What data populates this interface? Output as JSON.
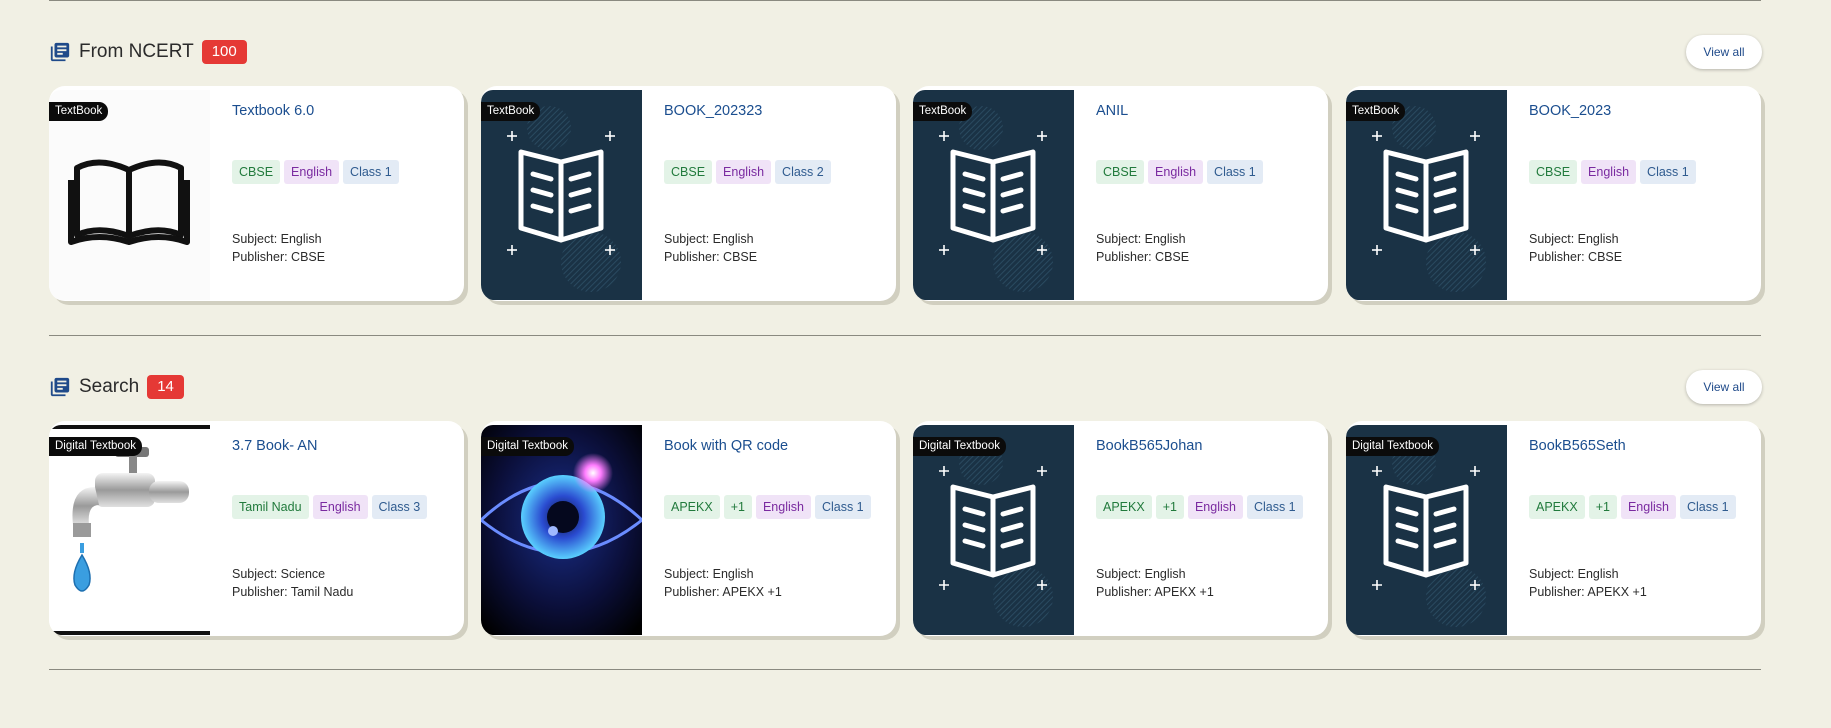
{
  "sections": [
    {
      "title": "From NCERT",
      "count": "100",
      "view_all": "View all",
      "icon": "library-books-icon",
      "cards": [
        {
          "type": "TextBook",
          "title": "Textbook 6.0",
          "tags": [
            "CBSE",
            "English",
            "Class 1"
          ],
          "subject": "Subject: English",
          "publisher": "Publisher: CBSE",
          "thumb": "open-book-photo"
        },
        {
          "type": "TextBook",
          "title": "BOOK_202323",
          "tags": [
            "CBSE",
            "English",
            "Class 2"
          ],
          "subject": "Subject: English",
          "publisher": "Publisher: CBSE",
          "thumb": "default-book-cover"
        },
        {
          "type": "TextBook",
          "title": "ANIL",
          "tags": [
            "CBSE",
            "English",
            "Class 1"
          ],
          "subject": "Subject: English",
          "publisher": "Publisher: CBSE",
          "thumb": "default-book-cover"
        },
        {
          "type": "TextBook",
          "title": "BOOK_2023",
          "tags": [
            "CBSE",
            "English",
            "Class 1"
          ],
          "subject": "Subject: English",
          "publisher": "Publisher: CBSE",
          "thumb": "default-book-cover"
        }
      ]
    },
    {
      "title": "Search",
      "count": "14",
      "view_all": "View all",
      "icon": "library-books-icon",
      "cards": [
        {
          "type": "Digital Textbook",
          "title": "3.7 Book- AN",
          "tags": [
            "Tamil Nadu",
            "English",
            "Class 3"
          ],
          "subject": "Subject: Science",
          "publisher": "Publisher: Tamil Nadu",
          "thumb": "water-tap-photo"
        },
        {
          "type": "Digital Textbook",
          "title": "Book with QR code",
          "tags": [
            "APEKX",
            "+1",
            "English",
            "Class 1"
          ],
          "subject": "Subject: English",
          "publisher": "Publisher: APEKX +1",
          "thumb": "glowing-eye-photo"
        },
        {
          "type": "Digital Textbook",
          "title": "BookB565Johan",
          "tags": [
            "APEKX",
            "+1",
            "English",
            "Class 1"
          ],
          "subject": "Subject: English",
          "publisher": "Publisher: APEKX +1",
          "thumb": "default-book-cover"
        },
        {
          "type": "Digital Textbook",
          "title": "BookB565Seth",
          "tags": [
            "APEKX",
            "+1",
            "English",
            "Class 1"
          ],
          "subject": "Subject: English",
          "publisher": "Publisher: APEKX +1",
          "thumb": "default-book-cover"
        }
      ]
    }
  ],
  "colors": {
    "background": "#f1f0e4",
    "badge": "#e53935",
    "title_link": "#1b4e8f",
    "cover_navy": "#1a3245"
  }
}
